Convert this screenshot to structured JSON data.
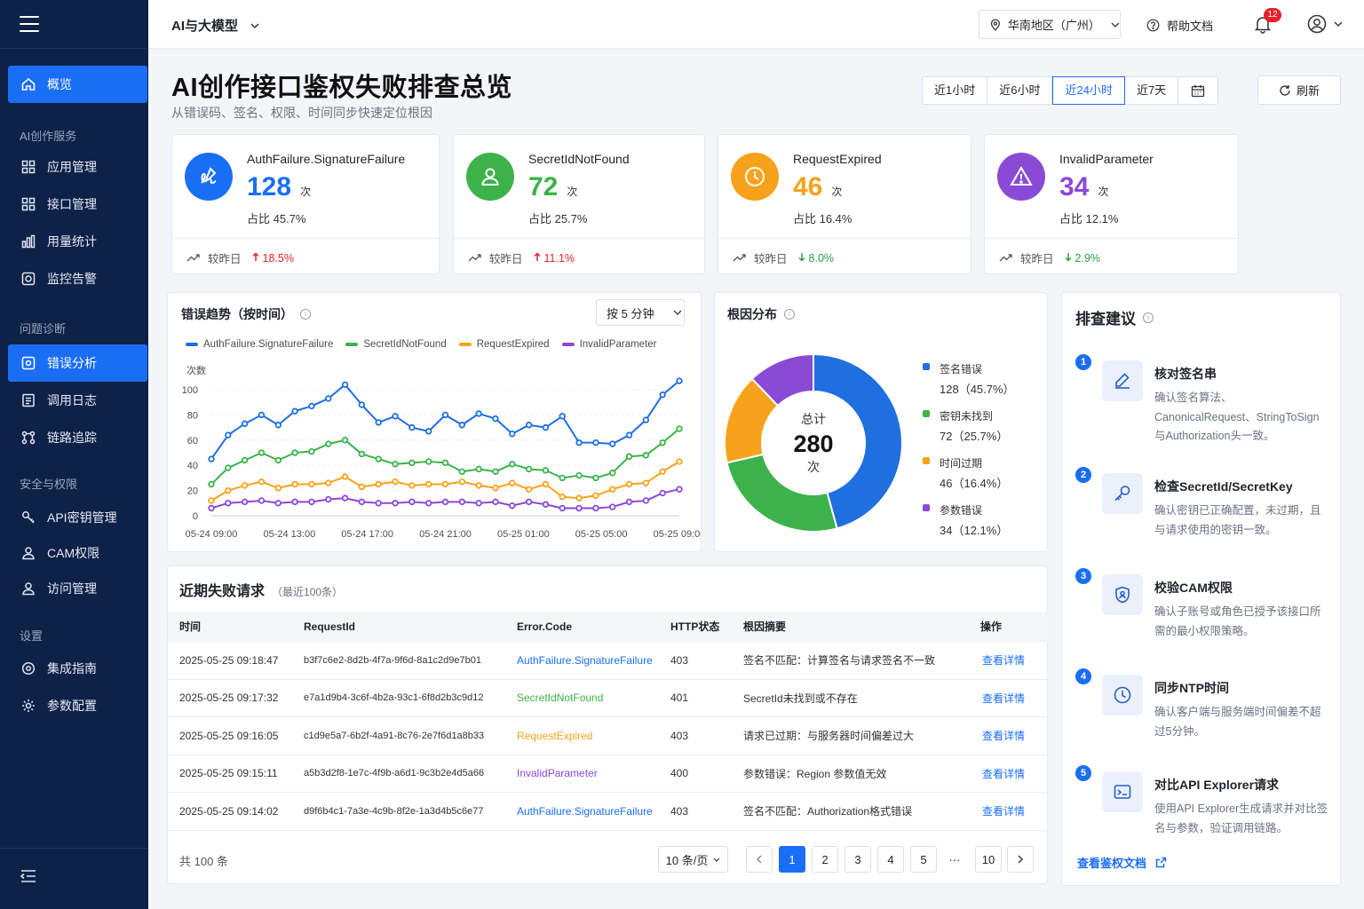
{
  "sidebar": {
    "items": [
      {
        "label": "概览",
        "icon": "home-icon"
      },
      {
        "label": "应用管理",
        "icon": "grid-icon"
      },
      {
        "label": "接口管理",
        "icon": "grid-icon"
      },
      {
        "label": "用量统计",
        "icon": "bar-chart-icon"
      },
      {
        "label": "监控告警",
        "icon": "monitor-alarm-icon"
      },
      {
        "label": "错误分析",
        "icon": "error-analysis-icon"
      },
      {
        "label": "调用日志",
        "icon": "log-icon"
      },
      {
        "label": "链路追踪",
        "icon": "trace-icon"
      },
      {
        "label": "API密钥管理",
        "icon": "key-icon"
      },
      {
        "label": "CAM权限",
        "icon": "user-icon"
      },
      {
        "label": "访问管理",
        "icon": "user-icon"
      },
      {
        "label": "集成指南",
        "icon": "settings-icon"
      },
      {
        "label": "参数配置",
        "icon": "gear-icon"
      }
    ],
    "groups": [
      "AI创作服务",
      "问题诊断",
      "安全与权限",
      "设置"
    ]
  },
  "header": {
    "product": "AI与大模型",
    "region": "华南地区（广州）",
    "help": "帮助文档",
    "notification_count": "12"
  },
  "page": {
    "title": "AI创作接口鉴权失败排查总览",
    "subtitle": "从错误码、签名、权限、时间同步快速定位根因",
    "ranges": [
      "近1小时",
      "近6小时",
      "近24小时",
      "近7天"
    ],
    "active_range": "近24小时",
    "refresh": "刷新"
  },
  "kpis": [
    {
      "name": "AuthFailure.SignatureFailure",
      "count": "128",
      "unit": "次",
      "share": "占比 45.7%",
      "compare_label": "较昨日",
      "change": "18.5%",
      "dir": "up",
      "color": "#1a6ef5",
      "icon": "signature-icon"
    },
    {
      "name": "SecretIdNotFound",
      "count": "72",
      "unit": "次",
      "share": "占比 25.7%",
      "compare_label": "较昨日",
      "change": "11.1%",
      "dir": "up",
      "color": "#3cb34a",
      "icon": "user-icon"
    },
    {
      "name": "RequestExpired",
      "count": "46",
      "unit": "次",
      "share": "占比 16.4%",
      "compare_label": "较昨日",
      "change": "8.0%",
      "dir": "down",
      "color": "#f7a21b",
      "icon": "clock-icon"
    },
    {
      "name": "InvalidParameter",
      "count": "34",
      "unit": "次",
      "share": "占比 12.1%",
      "compare_label": "较昨日",
      "change": "2.9%",
      "dir": "down",
      "color": "#8a4ad6",
      "icon": "warning-icon"
    }
  ],
  "trend": {
    "title": "错误趋势（按时间）",
    "interval": "按 5 分钟",
    "ylabel": "次数"
  },
  "chart_data": [
    {
      "type": "line",
      "ylabel": "次数",
      "ylim": [
        0,
        100
      ],
      "yticks": [
        "0",
        "20",
        "40",
        "60",
        "80",
        "100"
      ],
      "x_tick_labels": [
        "05-24 09:00",
        "05-24 13:00",
        "05-24 17:00",
        "05-24 21:00",
        "05-25 01:00",
        "05-25 05:00",
        "05-25 09:00"
      ],
      "grid": true,
      "legend": "top",
      "series": [
        {
          "name": "AuthFailure.SignatureFailure",
          "color": "#1f6fe0",
          "values": [
            45,
            64,
            73,
            80,
            72,
            83,
            87,
            93,
            104,
            88,
            74,
            79,
            70,
            67,
            80,
            72,
            81,
            77,
            65,
            72,
            70,
            79,
            58,
            58,
            57,
            64,
            76,
            96,
            107
          ]
        },
        {
          "name": "SecretIdNotFound",
          "color": "#3cb34a",
          "values": [
            25,
            38,
            44,
            50,
            44,
            50,
            51,
            57,
            60,
            49,
            45,
            41,
            42,
            43,
            42,
            35,
            37,
            35,
            41,
            37,
            36,
            30,
            32,
            30,
            34,
            47,
            48,
            58,
            69
          ]
        },
        {
          "name": "RequestExpired",
          "color": "#f7a21b",
          "values": [
            12,
            20,
            24,
            27,
            22,
            25,
            25,
            26,
            31,
            23,
            25,
            27,
            24,
            25,
            25,
            27,
            24,
            22,
            26,
            21,
            25,
            15,
            14,
            16,
            21,
            25,
            26,
            35,
            43
          ]
        },
        {
          "name": "InvalidParameter",
          "color": "#8a4ad6",
          "values": [
            6,
            10,
            11,
            12,
            10,
            11,
            11,
            13,
            14,
            11,
            10,
            10,
            11,
            10,
            11,
            11,
            10,
            11,
            8,
            11,
            9,
            6,
            6,
            6,
            7,
            11,
            12,
            18,
            21
          ]
        }
      ]
    },
    {
      "type": "pie",
      "title": "根因分布",
      "center_label": "总计",
      "total": "280",
      "unit": "次",
      "slices": [
        {
          "label": "签名错误",
          "value": 128,
          "text": "128（45.7%）",
          "color": "#1f6fe0"
        },
        {
          "label": "密钥未找到",
          "value": 72,
          "text": "72（25.7%）",
          "color": "#3cb34a"
        },
        {
          "label": "时间过期",
          "value": 46,
          "text": "46（16.4%）",
          "color": "#f7a21b"
        },
        {
          "label": "参数错误",
          "value": 34,
          "text": "34（12.1%）",
          "color": "#8a4ad6"
        }
      ]
    }
  ],
  "donut": {
    "title": "根因分布"
  },
  "table": {
    "title": "近期失败请求",
    "subtitle": "（最近100条）",
    "columns": [
      "时间",
      "RequestId",
      "Error.Code",
      "HTTP状态",
      "根因摘要",
      "操作"
    ],
    "rows": [
      {
        "time": "2025-05-25 09:18:47",
        "rid": "b3f7c6e2-8d2b-4f7a-9f6d-8a1c2d9e7b01",
        "code": "AuthFailure.SignatureFailure",
        "color": "#1a6ef5",
        "http": "403",
        "summary": "签名不匹配：计算签名与请求签名不一致",
        "action": "查看详情"
      },
      {
        "time": "2025-05-25 09:17:32",
        "rid": "e7a1d9b4-3c6f-4b2a-93c1-6f8d2b3c9d12",
        "code": "SecretIdNotFound",
        "color": "#3cb34a",
        "http": "401",
        "summary": "SecretId未找到或不存在",
        "action": "查看详情"
      },
      {
        "time": "2025-05-25 09:16:05",
        "rid": "c1d9e5a7-6b2f-4a91-8c76-2e7f6d1a8b33",
        "code": "RequestExpired",
        "color": "#f7a21b",
        "http": "403",
        "summary": "请求已过期：与服务器时间偏差过大",
        "action": "查看详情"
      },
      {
        "time": "2025-05-25 09:15:11",
        "rid": "a5b3d2f8-1e7c-4f9b-a6d1-9c3b2e4d5a66",
        "code": "InvalidParameter",
        "color": "#8a4ad6",
        "http": "400",
        "summary": "参数错误：Region 参数值无效",
        "action": "查看详情"
      },
      {
        "time": "2025-05-25 09:14:02",
        "rid": "d9f6b4c1-7a3e-4c9b-8f2e-1a3d4b5c6e77",
        "code": "AuthFailure.SignatureFailure",
        "color": "#1a6ef5",
        "http": "403",
        "summary": "签名不匹配：Authorization格式错误",
        "action": "查看详情"
      }
    ],
    "total": "共 100 条",
    "page_size": "10 条/页",
    "pages": [
      "1",
      "2",
      "3",
      "4",
      "5",
      "···",
      "10"
    ]
  },
  "advice": {
    "title": "排查建议",
    "steps": [
      {
        "n": "1",
        "title": "核对签名串",
        "desc": "确认签名算法、CanonicalRequest、StringToSign 与Authorization头一致。",
        "icon": "edit-icon"
      },
      {
        "n": "2",
        "title": "检查SecretId/SecretKey",
        "desc": "确认密钥已正确配置，未过期，且与请求使用的密钥一致。",
        "icon": "key-icon"
      },
      {
        "n": "3",
        "title": "校验CAM权限",
        "desc": "确认子账号或角色已授予该接口所需的最小权限策略。",
        "icon": "shield-icon"
      },
      {
        "n": "4",
        "title": "同步NTP时间",
        "desc": "确认客户端与服务端时间偏差不超过5分钟。",
        "icon": "clock-icon"
      },
      {
        "n": "5",
        "title": "对比API Explorer请求",
        "desc": "使用API Explorer生成请求并对比签名与参数，验证调用链路。",
        "icon": "terminal-icon"
      }
    ],
    "link": "查看鉴权文档"
  }
}
